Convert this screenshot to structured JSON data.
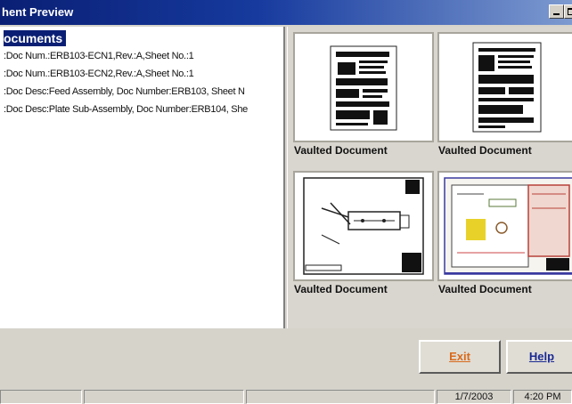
{
  "window": {
    "title": "hent Preview"
  },
  "tree": {
    "root_label": "ocuments",
    "items": [
      ":Doc Num.:ERB103-ECN1,Rev.:A,Sheet No.:1",
      ":Doc Num.:ERB103-ECN2,Rev.:A,Sheet No.:1",
      ":Doc Desc:Feed Assembly, Doc Number:ERB103, Sheet N",
      ":Doc Desc:Plate Sub-Assembly, Doc Number:ERB104, She"
    ]
  },
  "thumbnails": [
    {
      "caption": "Vaulted Document",
      "kind": "text-document"
    },
    {
      "caption": "Vaulted Document",
      "kind": "text-document"
    },
    {
      "caption": "Vaulted Document",
      "kind": "drawing"
    },
    {
      "caption": "Vaulted Document",
      "kind": "colored-drawing"
    }
  ],
  "buttons": {
    "exit_label": "Exit",
    "help_label": "Help"
  },
  "statusbar": {
    "date": "1/7/2003",
    "time": "4:20 PM"
  },
  "colors": {
    "title_bar": "#0a1f74",
    "exit_text": "#d86a1c",
    "help_text": "#1a2a92"
  }
}
